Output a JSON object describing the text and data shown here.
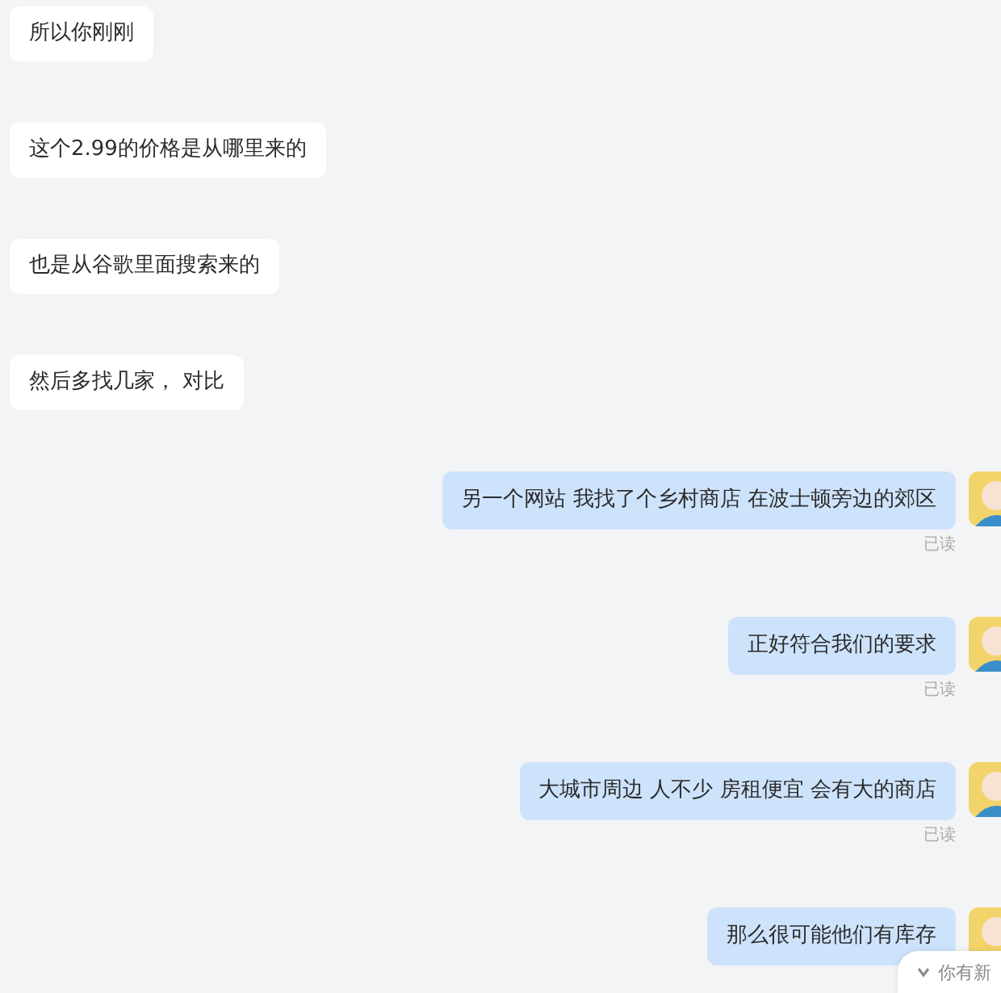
{
  "messages": [
    {
      "kind": "incoming",
      "text": "所以你刚刚"
    },
    {
      "kind": "incoming",
      "text": "这个2.99的价格是从哪里来的"
    },
    {
      "kind": "incoming",
      "text": "也是从谷歌里面搜索来的"
    },
    {
      "kind": "incoming",
      "text": "然后多找几家， 对比"
    },
    {
      "kind": "outgoing",
      "text": "另一个网站 我找了个乡村商店 在波士顿旁边的郊区",
      "receipt": "已读"
    },
    {
      "kind": "outgoing",
      "text": "正好符合我们的要求",
      "receipt": "已读"
    },
    {
      "kind": "outgoing",
      "text": "大城市周边 人不少 房租便宜 会有大的商店",
      "receipt": "已读"
    },
    {
      "kind": "outgoing",
      "text": "那么很可能他们有库存"
    }
  ],
  "new_message_pill": {
    "label": "你有新"
  }
}
